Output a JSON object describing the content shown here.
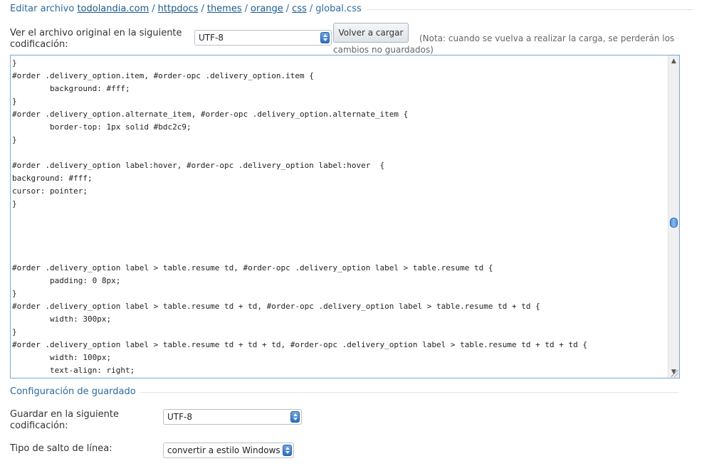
{
  "breadcrumb": {
    "prefix": "Editar archivo",
    "parts": [
      "todolandia.com",
      "httpdocs",
      "themes",
      "orange",
      "css"
    ],
    "file": "global.css",
    "separator": "/"
  },
  "original_encoding": {
    "label_line1": "Ver el archivo original en la siguiente",
    "label_line2": "codificación:",
    "selected": "UTF-8",
    "reload_button": "Volver a cargar",
    "note_line1": "(Nota: cuando se vuelva a realizar la carga, se perderán los",
    "note_line2": "cambios no guardados)"
  },
  "editor": {
    "lines": [
      "}",
      "#order .delivery_option.item, #order-opc .delivery_option.item {",
      "\tbackground: #fff;",
      "}",
      "#order .delivery_option.alternate_item, #order-opc .delivery_option.alternate_item {",
      "\tborder-top: 1px solid #bdc2c9;",
      "}",
      "",
      "#order .delivery_option label:hover, #order-opc .delivery_option label:hover  {",
      "background: #fff;",
      "cursor: pointer;",
      "}",
      "",
      "",
      "",
      "",
      "#order .delivery_option label > table.resume td, #order-opc .delivery_option label > table.resume td {",
      "\tpadding: 0 8px;",
      "}",
      "#order .delivery_option label > table.resume td + td, #order-opc .delivery_option label > table.resume td + td {",
      "\twidth: 300px;",
      "}",
      "#order .delivery_option label > table.resume td + td + td, #order-opc .delivery_option label > table.resume td + td + td {",
      "\twidth: 100px;",
      "\ttext-align: right;",
      "}"
    ],
    "scroll_position": 0.52,
    "scroll_up_icon": "▲",
    "scroll_down_icon": "▼"
  },
  "save_settings": {
    "legend": "Configuración de guardado",
    "encoding_label_line1": "Guardar en la siguiente",
    "encoding_label_line2": "codificación:",
    "encoding_selected": "UTF-8",
    "linebreak_label": "Tipo de salto de línea:",
    "linebreak_selected": "convertir a estilo Windows"
  },
  "colors": {
    "legend": "#2b6a9e",
    "editor_border": "#7aa7d6",
    "select_arrow": "#2d6fc4"
  }
}
